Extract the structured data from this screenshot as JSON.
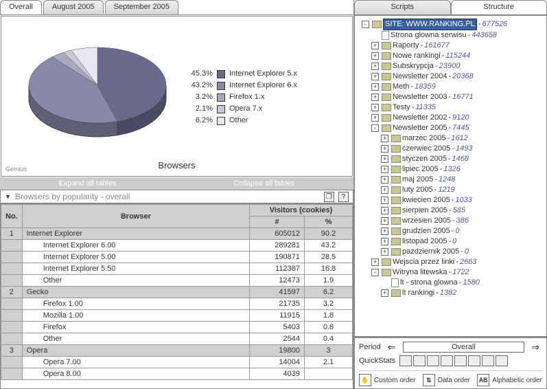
{
  "tabs": {
    "left": [
      "Overall",
      "August 2005",
      "September 2005"
    ],
    "right": [
      "Scripts",
      "Structure"
    ]
  },
  "chart_data": {
    "type": "pie",
    "title": "Browsers",
    "series": [
      {
        "name": "Internet Explorer 5.x",
        "value": 45.3,
        "color": "#6a6a8c"
      },
      {
        "name": "Internet Explorer 6.x",
        "value": 43.2,
        "color": "#8888a8"
      },
      {
        "name": "Firefox 1.x",
        "value": 3.2,
        "color": "#a8a8c0"
      },
      {
        "name": "Opera 7.x",
        "value": 2.1,
        "color": "#c8c8d8"
      },
      {
        "name": "Other",
        "value": 6.2,
        "color": "#e8e8f0"
      }
    ],
    "watermark": "Gemius"
  },
  "toolbar": {
    "expand": "Expand all tables",
    "collapse": "Collapse all tables"
  },
  "table": {
    "title": "Browsers by popularity - overall",
    "cols": {
      "no": "No.",
      "browser": "Browser",
      "visitors": "Visitors (cookies)",
      "count": "#",
      "pct": "%"
    },
    "groups": [
      {
        "n": 1,
        "name": "Internet Explorer",
        "count": 605012,
        "pct": 90.2,
        "rows": [
          {
            "name": "Internet Explorer 6.00",
            "count": 289281,
            "pct": 43.2
          },
          {
            "name": "Internet Explorer 5.00",
            "count": 190871,
            "pct": 28.5
          },
          {
            "name": "Internet Explorer 5.50",
            "count": 112387,
            "pct": 16.8
          },
          {
            "name": "Other",
            "count": 12473,
            "pct": 1.9
          }
        ]
      },
      {
        "n": 2,
        "name": "Gecko",
        "count": 41597,
        "pct": 6.2,
        "rows": [
          {
            "name": "Firefox 1.00",
            "count": 21735,
            "pct": 3.2
          },
          {
            "name": "Mozilla 1.00",
            "count": 11915,
            "pct": 1.8
          },
          {
            "name": "Firefox",
            "count": 5403,
            "pct": 0.8
          },
          {
            "name": "Other",
            "count": 2544,
            "pct": 0.4
          }
        ]
      },
      {
        "n": 3,
        "name": "Opera",
        "count": 19800,
        "pct": 3.0,
        "rows": [
          {
            "name": "Opera 7.00",
            "count": 14004,
            "pct": 2.1
          },
          {
            "name": "Opera 8.00",
            "count": 4039,
            "pct": ""
          }
        ]
      }
    ]
  },
  "tree": [
    {
      "d": 1,
      "exp": "-",
      "t": "fld",
      "label": "SITE: WWW.RANKING.PL",
      "count": 677526,
      "sel": true
    },
    {
      "d": 2,
      "exp": "",
      "t": "doc",
      "label": "Strona glowna serwisu",
      "count": 443658
    },
    {
      "d": 2,
      "exp": "+",
      "t": "fld",
      "label": "Raporty",
      "count": 161677
    },
    {
      "d": 2,
      "exp": "+",
      "t": "fld",
      "label": "Nowe rankingi",
      "count": 115244
    },
    {
      "d": 2,
      "exp": "+",
      "t": "fld",
      "label": "Subskrypcja",
      "count": 23900
    },
    {
      "d": 2,
      "exp": "+",
      "t": "fld",
      "label": "Newsletter 2004",
      "count": 20368
    },
    {
      "d": 2,
      "exp": "+",
      "t": "fld",
      "label": "Meth",
      "count": 18359
    },
    {
      "d": 2,
      "exp": "+",
      "t": "fld",
      "label": "Newsletter 2003",
      "count": 16771
    },
    {
      "d": 2,
      "exp": "+",
      "t": "fld",
      "label": "Testy",
      "count": 11335
    },
    {
      "d": 2,
      "exp": "+",
      "t": "fld",
      "label": "Newsletter 2002",
      "count": 9120
    },
    {
      "d": 2,
      "exp": "-",
      "t": "fld",
      "label": "Newsletter 2005",
      "count": 7445
    },
    {
      "d": 3,
      "exp": "+",
      "t": "fld",
      "label": "marzec 2005",
      "count": 1612
    },
    {
      "d": 3,
      "exp": "+",
      "t": "fld",
      "label": "czerwiec 2005",
      "count": 1493
    },
    {
      "d": 3,
      "exp": "+",
      "t": "fld",
      "label": "styczen 2005",
      "count": 1468
    },
    {
      "d": 3,
      "exp": "+",
      "t": "fld",
      "label": "lipiec 2005",
      "count": 1326
    },
    {
      "d": 3,
      "exp": "+",
      "t": "fld",
      "label": "maj 2005",
      "count": 1248
    },
    {
      "d": 3,
      "exp": "+",
      "t": "fld",
      "label": "luty 2005",
      "count": 1219
    },
    {
      "d": 3,
      "exp": "+",
      "t": "fld",
      "label": "kwiecien 2005",
      "count": 1033
    },
    {
      "d": 3,
      "exp": "+",
      "t": "fld",
      "label": "sierpien 2005",
      "count": 585
    },
    {
      "d": 3,
      "exp": "+",
      "t": "fld",
      "label": "wrzesien 2005",
      "count": 386
    },
    {
      "d": 3,
      "exp": "+",
      "t": "fld",
      "label": "grudzien 2005",
      "count": 0
    },
    {
      "d": 3,
      "exp": "+",
      "t": "fld",
      "label": "listopad 2005",
      "count": 0
    },
    {
      "d": 3,
      "exp": "+",
      "t": "fld",
      "label": "pazdziernik 2005",
      "count": 0
    },
    {
      "d": 2,
      "exp": "+",
      "t": "fld",
      "label": "Wejscia przez linki",
      "count": 2663
    },
    {
      "d": 2,
      "exp": "-",
      "t": "fld",
      "label": "Witryna litewska",
      "count": 1722
    },
    {
      "d": 3,
      "exp": "",
      "t": "doc",
      "label": "lt - strona glowna",
      "count": 1580
    },
    {
      "d": 3,
      "exp": "+",
      "t": "fld",
      "label": "lt   rankingi",
      "count": 1382
    }
  ],
  "bottom": {
    "period_lbl": "Period",
    "period_val": "Overall",
    "qs_lbl": "QuickStats",
    "orders": {
      "custom": "Custom order",
      "data": "Data order",
      "alpha": "Alphabetic order"
    }
  }
}
